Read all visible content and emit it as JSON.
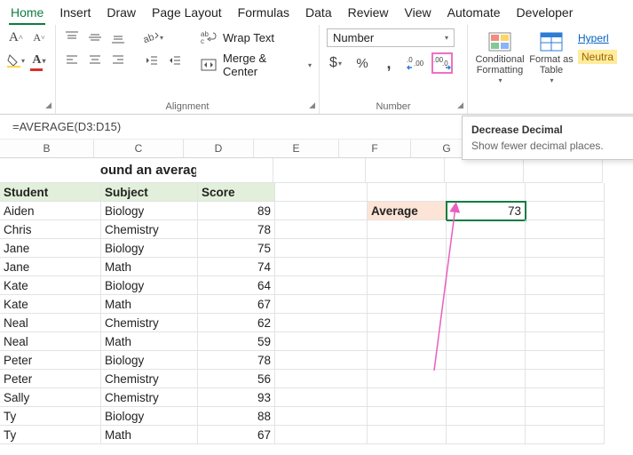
{
  "tabs": [
    "Home",
    "Insert",
    "Draw",
    "Page Layout",
    "Formulas",
    "Data",
    "Review",
    "View",
    "Automate",
    "Developer"
  ],
  "activeTab": "Home",
  "ribbon": {
    "wrapText": "Wrap Text",
    "mergeCenter": "Merge & Center",
    "alignmentLabel": "Alignment",
    "numberLabel": "Number",
    "numberFormat": "Number",
    "conditional": "Conditional Formatting",
    "formatAsTable": "Format as Table",
    "hyperl": "Hyperl",
    "neutra": "Neutra"
  },
  "formulaBar": "=AVERAGE(D3:D15)",
  "tooltip": {
    "title": "Decrease Decimal",
    "body": "Show fewer decimal places."
  },
  "columns": [
    "B",
    "C",
    "D",
    "E",
    "F",
    "G"
  ],
  "sheetTitle": "Round an average",
  "headers": {
    "student": "Student",
    "subject": "Subject",
    "score": "Score"
  },
  "rows": [
    {
      "student": "Aiden",
      "subject": "Biology",
      "score": "89"
    },
    {
      "student": "Chris",
      "subject": "Chemistry",
      "score": "78"
    },
    {
      "student": "Jane",
      "subject": "Biology",
      "score": "75"
    },
    {
      "student": "Jane",
      "subject": "Math",
      "score": "74"
    },
    {
      "student": "Kate",
      "subject": "Biology",
      "score": "64"
    },
    {
      "student": "Kate",
      "subject": "Math",
      "score": "67"
    },
    {
      "student": "Neal",
      "subject": "Chemistry",
      "score": "62"
    },
    {
      "student": "Neal",
      "subject": "Math",
      "score": "59"
    },
    {
      "student": "Peter",
      "subject": "Biology",
      "score": "78"
    },
    {
      "student": "Peter",
      "subject": "Chemistry",
      "score": "56"
    },
    {
      "student": "Sally",
      "subject": "Chemistry",
      "score": "93"
    },
    {
      "student": "Ty",
      "subject": "Biology",
      "score": "88"
    },
    {
      "student": "Ty",
      "subject": "Math",
      "score": "67"
    }
  ],
  "average": {
    "label": "Average",
    "value": "73"
  }
}
